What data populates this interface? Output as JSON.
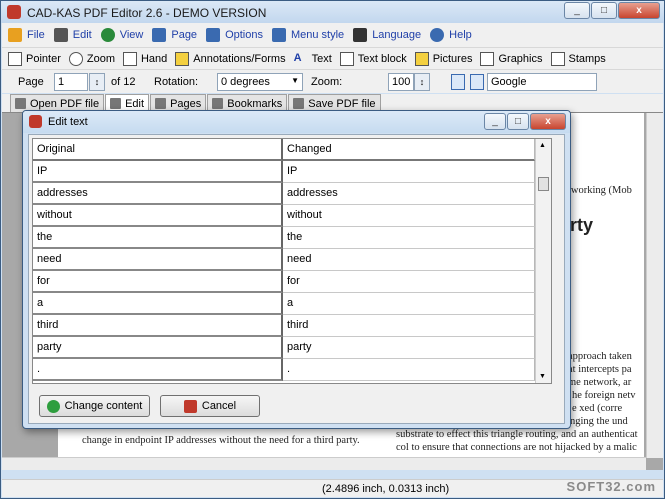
{
  "app": {
    "title": "CAD-KAS PDF Editor 2.6 - DEMO VERSION",
    "window_buttons": [
      "_",
      "□",
      "x"
    ]
  },
  "menu": [
    {
      "label": "File",
      "icon": "folder-icon",
      "color": "#e8a020"
    },
    {
      "label": "Edit",
      "icon": "hammer-icon",
      "color": "#555555"
    },
    {
      "label": "View",
      "icon": "globe-icon",
      "color": "#2a8a3a"
    },
    {
      "label": "Page",
      "icon": "page-icon",
      "color": "#3a6ab0"
    },
    {
      "label": "Options",
      "icon": "checklist-icon",
      "color": "#3a6ab0"
    },
    {
      "label": "Menu style",
      "icon": "layout-icon",
      "color": "#3a6ab0"
    },
    {
      "label": "Language",
      "icon": "book-icon",
      "color": "#333333"
    },
    {
      "label": "Help",
      "icon": "help-icon",
      "color": "#3a6ab0"
    }
  ],
  "tools": [
    {
      "label": "Pointer",
      "icon": "pointer-icon"
    },
    {
      "label": "Zoom",
      "icon": "magnifier-icon"
    },
    {
      "label": "Hand",
      "icon": "hand-icon"
    },
    {
      "label": "Annotations/Forms",
      "icon": "annotation-icon"
    },
    {
      "label": "Text",
      "icon": "text-a-icon"
    },
    {
      "label": "Text block",
      "icon": "text-block-icon"
    },
    {
      "label": "Pictures",
      "icon": "picture-icon"
    },
    {
      "label": "Graphics",
      "icon": "graphics-icon"
    },
    {
      "label": "Stamps",
      "icon": "stamp-icon"
    }
  ],
  "pagebar": {
    "page_label": "Page",
    "page_value": "1",
    "of_label": "of 12",
    "rotation_label": "Rotation:",
    "rotation_value": "0 degrees",
    "zoom_label": "Zoom:",
    "zoom_value": "100",
    "search_value": "Google"
  },
  "tabs": [
    {
      "label": "Open PDF file",
      "icon": "open-pdf-icon"
    },
    {
      "label": "Edit",
      "icon": "edit-icon"
    },
    {
      "label": "Pages",
      "icon": "pages-icon"
    },
    {
      "label": "Bookmarks",
      "icon": "bookmarks-icon"
    },
    {
      "label": "Save PDF file",
      "icon": "save-pdf-icon"
    }
  ],
  "document_lines": [
    "tworking (Mob",
    "rty",
    "approach taken",
    "at intercepts pa",
    "me network, ar",
    "he foreign netv",
    "e   xed (corre",
    "nging the und",
    "substrate to effect this triangle routing, and an authenticat",
    "col to ensure that connections are not hijacked by a malic",
    "change in endpoint IP addresses without the need for a third party."
  ],
  "dialog": {
    "title": "Edit text",
    "columns": [
      "Original",
      "Changed"
    ],
    "rows": [
      [
        "IP",
        "IP"
      ],
      [
        "addresses",
        "addresses"
      ],
      [
        "without",
        "without"
      ],
      [
        "the",
        "the"
      ],
      [
        "need",
        "need"
      ],
      [
        "for",
        "for"
      ],
      [
        "a",
        "a"
      ],
      [
        "third",
        "third"
      ],
      [
        "party",
        "party"
      ],
      [
        ".",
        "."
      ]
    ],
    "change_button": "Change content",
    "cancel_button": "Cancel"
  },
  "status": {
    "coordinates": "(2.4896 inch, 0.0313 inch)"
  },
  "watermark": "SOFT32.com"
}
